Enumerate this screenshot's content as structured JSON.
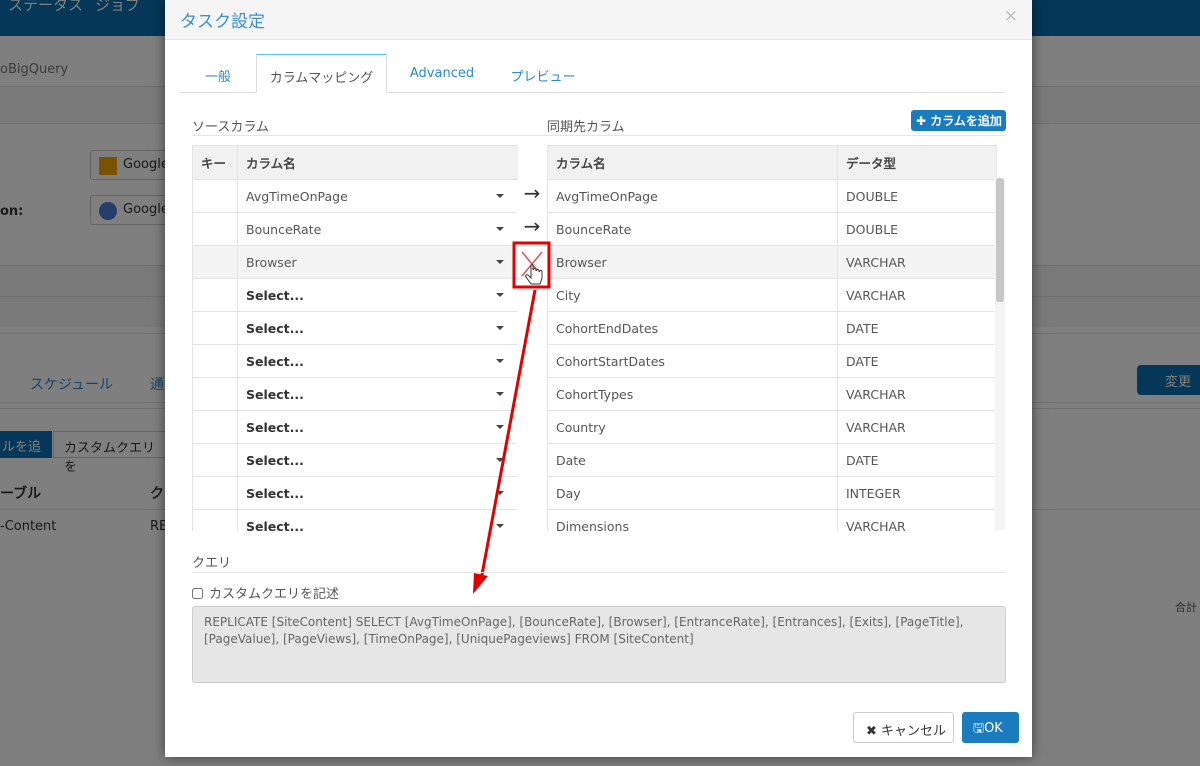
{
  "background": {
    "nav": [
      "ステータス",
      "ジョブ"
    ],
    "job_name": "oBigQuery",
    "source_button": "Google",
    "dest_label": "on:",
    "dest_button": "Google",
    "tabs": [
      "スケジュール",
      "通"
    ],
    "add_table_button": "ルを追加",
    "custom_query_button": "カスタムクエリを",
    "table_headers": [
      "ーブル",
      "ク"
    ],
    "table_row": [
      "-Content",
      "RE"
    ],
    "save_button": "変更",
    "total_label": "合計"
  },
  "modal": {
    "title": "タスク設定",
    "close": "×",
    "tabs": [
      {
        "label": "一般"
      },
      {
        "label": "カラムマッピング",
        "active": true
      },
      {
        "label": "Advanced"
      },
      {
        "label": "プレビュー"
      }
    ],
    "source_section": "ソースカラム",
    "dest_section": "同期先カラム",
    "add_column_button": "カラムを追加",
    "source_headers": [
      "キー",
      "カラム名"
    ],
    "source_rows": [
      {
        "value": "AvgTimeOnPage",
        "mapped": true
      },
      {
        "value": "BounceRate",
        "mapped": true
      },
      {
        "value": "Browser",
        "mapped": true
      },
      {
        "value": "Select..."
      },
      {
        "value": "Select..."
      },
      {
        "value": "Select..."
      },
      {
        "value": "Select..."
      },
      {
        "value": "Select..."
      },
      {
        "value": "Select..."
      },
      {
        "value": "Select..."
      },
      {
        "value": "Select..."
      }
    ],
    "dest_headers": [
      "カラム名",
      "データ型"
    ],
    "dest_rows": [
      [
        "AvgTimeOnPage",
        "DOUBLE"
      ],
      [
        "BounceRate",
        "DOUBLE"
      ],
      [
        "Browser",
        "VARCHAR"
      ],
      [
        "City",
        "VARCHAR"
      ],
      [
        "CohortEndDates",
        "DATE"
      ],
      [
        "CohortStartDates",
        "DATE"
      ],
      [
        "CohortTypes",
        "VARCHAR"
      ],
      [
        "Country",
        "VARCHAR"
      ],
      [
        "Date",
        "DATE"
      ],
      [
        "Day",
        "INTEGER"
      ],
      [
        "Dimensions",
        "VARCHAR"
      ]
    ],
    "query_section": "クエリ",
    "custom_query_checkbox": "カスタムクエリを記述",
    "custom_query_checked": false,
    "query_text": "REPLICATE [SiteContent] SELECT [AvgTimeOnPage], [BounceRate], [Browser], [EntranceRate], [Entrances], [Exits], [PageTitle], [PageValue], [PageViews], [TimeOnPage], [UniquePageviews] FROM [SiteContent]",
    "cancel_button": "キャンセル",
    "ok_button": "OK",
    "colors": {
      "primary": "#1a7bbf",
      "annotation": "#e00000"
    }
  }
}
